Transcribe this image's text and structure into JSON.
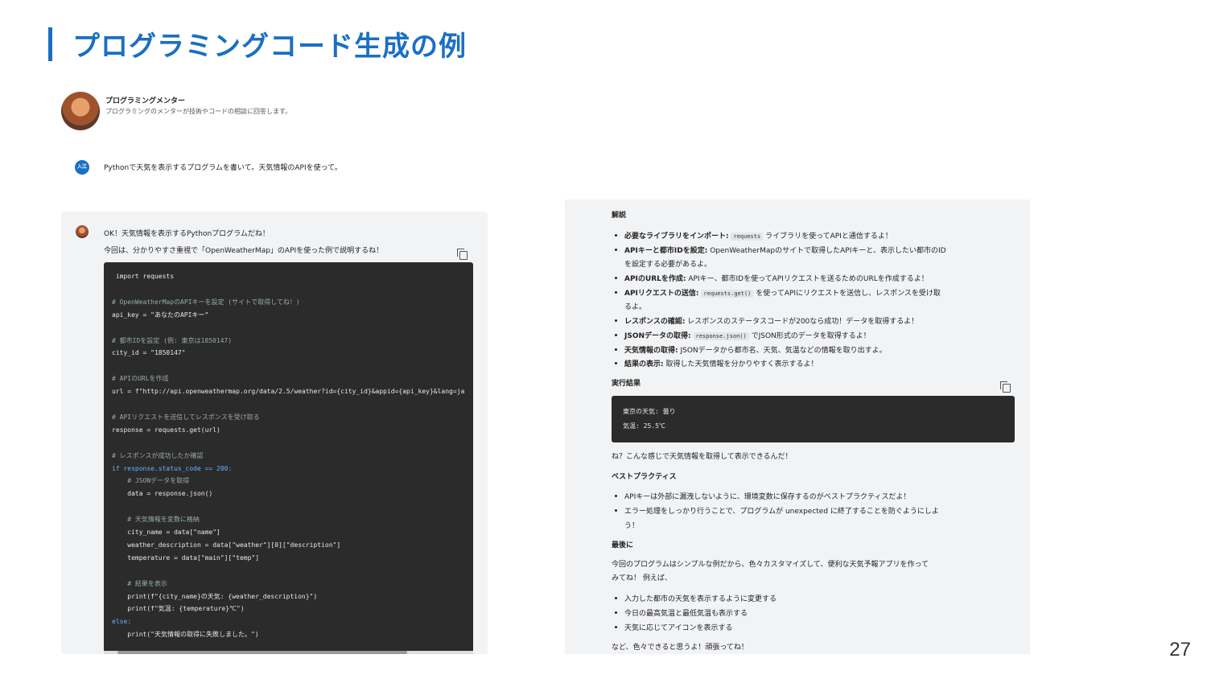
{
  "slide": {
    "title": "プログラミングコード生成の例",
    "page_number": "27"
  },
  "mentor": {
    "name": "プログラミングメンター",
    "description": "プログラミングのメンターが技術やコードの相談に回答します。"
  },
  "user": {
    "badge": "入江",
    "message": "Pythonで天気を表示するプログラムを書いて。天気情報のAPIを使って。"
  },
  "reply": {
    "line1": "OK！天気情報を表示するPythonプログラムだね！",
    "line2": "今回は、分かりやすさ重視で「OpenWeatherMap」のAPIを使った例で説明するね！"
  },
  "code_lines": [
    {
      "t": " import requests",
      "k": ""
    },
    {
      "t": "",
      "k": ""
    },
    {
      "t": "# OpenWeatherMapのAPIキーを設定 (サイトで取得してね！)",
      "k": "cm"
    },
    {
      "t": "api_key = \"あなたのAPIキー\"",
      "k": ""
    },
    {
      "t": "",
      "k": ""
    },
    {
      "t": "# 都市IDを設定 (例: 東京は1850147)",
      "k": "cm"
    },
    {
      "t": "city_id = \"1850147\"",
      "k": ""
    },
    {
      "t": "",
      "k": ""
    },
    {
      "t": "# APIのURLを作成",
      "k": "cm"
    },
    {
      "t": "url = f\"http://api.openweathermap.org/data/2.5/weather?id={city_id}&appid={api_key}&lang=ja",
      "k": ""
    },
    {
      "t": "",
      "k": ""
    },
    {
      "t": "# APIリクエストを送信してレスポンスを受け取る",
      "k": "cm"
    },
    {
      "t": "response = requests.get(url)",
      "k": ""
    },
    {
      "t": "",
      "k": ""
    },
    {
      "t": "# レスポンスが成功したか確認",
      "k": "cm"
    },
    {
      "t": "if response.status_code == 200:",
      "k": "kw"
    },
    {
      "t": "    # JSONデータを取得",
      "k": "cm"
    },
    {
      "t": "    data = response.json()",
      "k": ""
    },
    {
      "t": "",
      "k": ""
    },
    {
      "t": "    # 天気情報を変数に格納",
      "k": "cm"
    },
    {
      "t": "    city_name = data[\"name\"]",
      "k": ""
    },
    {
      "t": "    weather_description = data[\"weather\"][0][\"description\"]",
      "k": ""
    },
    {
      "t": "    temperature = data[\"main\"][\"temp\"]",
      "k": ""
    },
    {
      "t": "",
      "k": ""
    },
    {
      "t": "    # 結果を表示",
      "k": "cm"
    },
    {
      "t": "    print(f\"{city_name}の天気: {weather_description}\")",
      "k": ""
    },
    {
      "t": "    print(f\"気温: {temperature}℃\")",
      "k": ""
    },
    {
      "t": "else:",
      "k": "kw"
    },
    {
      "t": "    print(\"天気情報の取得に失敗しました。\")",
      "k": ""
    }
  ],
  "explain": {
    "heading": "解説",
    "items": [
      {
        "b": "必要なライブラリをインポート:",
        "pre": "",
        "code": "requests",
        "post": "ライブラリを使ってAPIと通信するよ！"
      },
      {
        "b": "APIキーと都市IDを設定:",
        "pre": " OpenWeatherMapのサイトで取得したAPIキーと、表示したい都市のID",
        "code": "",
        "post": ""
      },
      {
        "b": "",
        "pre": "を設定する必要があるよ。",
        "code": "",
        "post": ""
      },
      {
        "b": "APIのURLを作成:",
        "pre": " APIキー、都市IDを使ってAPIリクエストを送るためのURLを作成するよ！",
        "code": "",
        "post": ""
      },
      {
        "b": "APIリクエストの送信:",
        "pre": "",
        "code": "requests.get()",
        "post": "を使ってAPIにリクエストを送信し、レスポンスを受け取"
      },
      {
        "b": "",
        "pre": "るよ。",
        "code": "",
        "post": ""
      },
      {
        "b": "レスポンスの確認:",
        "pre": " レスポンスのステータスコードが200なら成功！データを取得するよ！",
        "code": "",
        "post": ""
      },
      {
        "b": "JSONデータの取得:",
        "pre": "",
        "code": "response.json()",
        "post": "でJSON形式のデータを取得するよ！"
      },
      {
        "b": "天気情報の取得:",
        "pre": " JSONデータから都市名、天気、気温などの情報を取り出すよ。",
        "code": "",
        "post": ""
      },
      {
        "b": "結果の表示:",
        "pre": " 取得した天気情報を分かりやすく表示するよ！",
        "code": "",
        "post": ""
      }
    ]
  },
  "result": {
    "heading": "実行結果",
    "line1": "東京の天気: 曇り",
    "line2": "気温: 25.5℃"
  },
  "after_result": "ね？こんな感じで天気情報を取得して表示できるんだ！",
  "best": {
    "heading": "ベストプラクティス",
    "item1": "APIキーは外部に漏洩しないように、環境変数に保存するのがベストプラクティスだよ！",
    "item2a": "エラー処理をしっかり行うことで、プログラムが unexpected に終了することを防ぐようにしよ",
    "item2b": "う！"
  },
  "final": {
    "heading": "最後に",
    "para1": "今回のプログラムはシンプルな例だから、色々カスタマイズして、便利な天気予報アプリを作って",
    "para2": "みてね！ 例えば、",
    "items": [
      "入力した都市の天気を表示するように変更する",
      "今日の最高気温と最低気温も表示する",
      "天気に応じてアイコンを表示する"
    ],
    "closing": "など、色々できると思うよ！頑張ってね！"
  }
}
